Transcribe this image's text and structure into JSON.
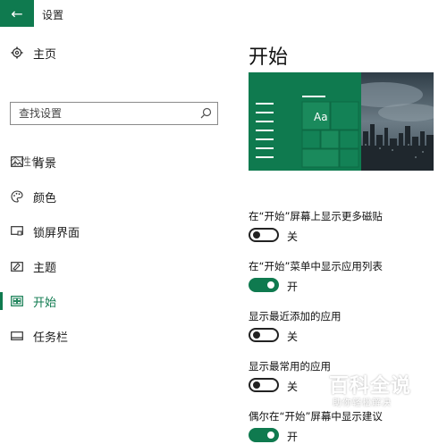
{
  "window": {
    "title": "设置",
    "back_icon": "back-arrow-icon"
  },
  "sidebar": {
    "home_label": "主页",
    "search_placeholder": "查找设置",
    "section_label": "个性化",
    "items": [
      {
        "label": "背景",
        "icon": "picture-icon"
      },
      {
        "label": "颜色",
        "icon": "palette-icon"
      },
      {
        "label": "锁屏界面",
        "icon": "lock-screen-icon"
      },
      {
        "label": "主题",
        "icon": "theme-icon"
      },
      {
        "label": "开始",
        "icon": "start-icon",
        "active": true
      },
      {
        "label": "任务栏",
        "icon": "taskbar-icon"
      }
    ]
  },
  "main": {
    "title": "开始",
    "preview_tile_text": "Aa",
    "settings": [
      {
        "label": "在“开始”屏幕上显示更多磁贴",
        "on": false,
        "state": "关"
      },
      {
        "label": "在“开始”菜单中显示应用列表",
        "on": true,
        "state": "开"
      },
      {
        "label": "显示最近添加的应用",
        "on": false,
        "state": "关"
      },
      {
        "label": "显示最常用的应用",
        "on": false,
        "state": "关"
      },
      {
        "label": "偶尔在“开始”屏幕中显示建议",
        "on": true,
        "state": "开"
      }
    ]
  },
  "watermark": {
    "title": "百科全说",
    "subtitle": "助你轻松解决"
  },
  "colors": {
    "accent": "#0f7a4f"
  }
}
